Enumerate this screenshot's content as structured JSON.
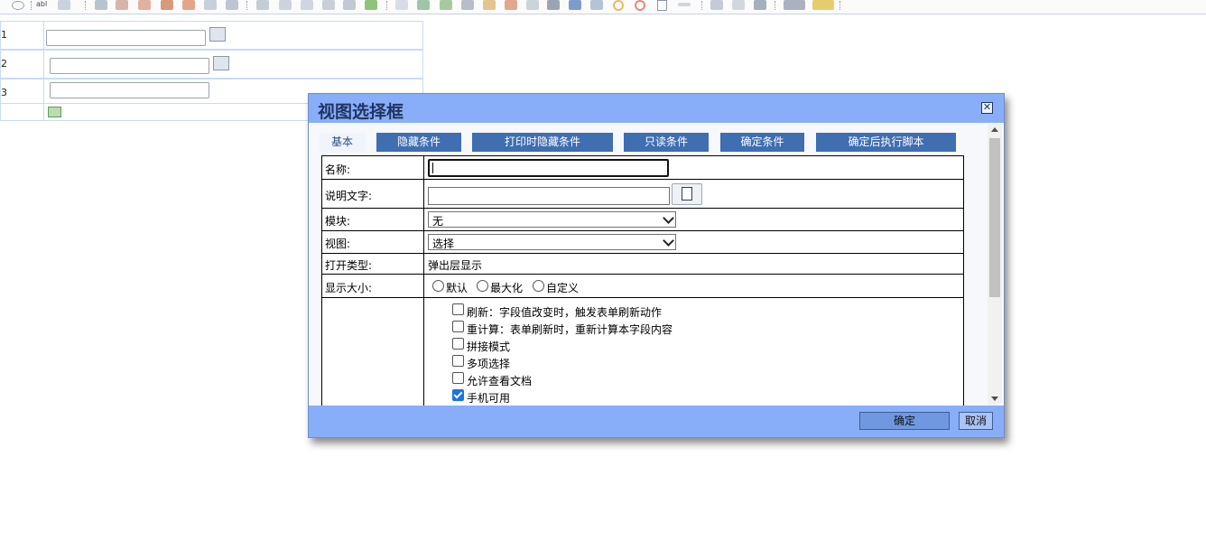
{
  "toolbar": {
    "items": [
      "toolbar-icons"
    ]
  },
  "background_form": {
    "rows": [
      {
        "label": "1"
      },
      {
        "label": "2"
      },
      {
        "label": "3"
      },
      {
        "label": ""
      }
    ]
  },
  "dialog": {
    "title": "视图选择框",
    "close_label": "✕",
    "tabs": [
      {
        "label": "基本",
        "active": true
      },
      {
        "label": "隐藏条件",
        "active": false
      },
      {
        "label": "打印时隐藏条件",
        "active": false
      },
      {
        "label": "只读条件",
        "active": false
      },
      {
        "label": "确定条件",
        "active": false
      },
      {
        "label": "确定后执行脚本",
        "active": false
      }
    ],
    "fields": {
      "name_label": "名称:",
      "name_value": "",
      "desc_label": "说明文字:",
      "desc_value": "",
      "module_label": "模块:",
      "module_value": "无",
      "view_label": "视图:",
      "view_value": "选择",
      "open_type_label": "打开类型:",
      "open_type_value": "弹出层显示",
      "size_label": "显示大小:",
      "size_options": [
        "默认",
        "最大化",
        "自定义"
      ]
    },
    "options": [
      {
        "label": "刷新：字段值改变时，触发表单刷新动作",
        "checked": false
      },
      {
        "label": "重计算：表单刷新时，重新计算本字段内容",
        "checked": false
      },
      {
        "label": "拼接模式",
        "checked": false
      },
      {
        "label": "多项选择",
        "checked": false
      },
      {
        "label": "允许查看文档",
        "checked": false
      },
      {
        "label": "手机可用",
        "checked": true
      }
    ],
    "ok_label": "确定",
    "cancel_label": "取消"
  },
  "colors": {
    "title_bar": "#88aef9",
    "tab_bg": "#3f6eb1",
    "title_text": "#1f3561"
  }
}
